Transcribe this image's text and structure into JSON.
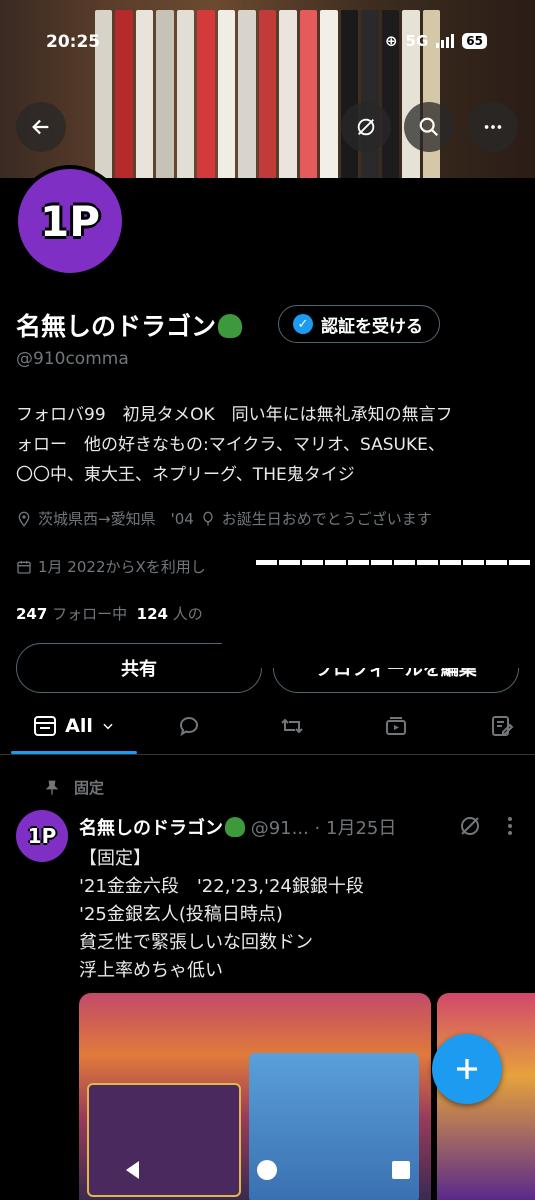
{
  "status_bar": {
    "time": "20:25",
    "network": "5G",
    "battery": "65"
  },
  "profile": {
    "avatar_text": "1P",
    "name": "名無しのドラゴン",
    "verify_button": "認証を受ける",
    "handle": "@910comma",
    "bio_lines": [
      "フォロバ99　初見タメOK　同い年には無礼承知の無言フ",
      "ォロー　他の好きなもの:マイクラ、マリオ、SASUKE、",
      "〇〇中、東大王、ネプリーグ、THE鬼タイジ"
    ],
    "location": "茨城県西→愛知県　'04",
    "birthday": "お誕生日おめでとうございます",
    "joined": "1月 2022からXを利用し",
    "following_count": "247",
    "following_label": "フォロー中",
    "followers_count": "124",
    "followers_label": "人の",
    "share_button": "共有",
    "edit_button": "プロフィールを編集"
  },
  "tabs": {
    "all_label": "All"
  },
  "pinned_post": {
    "pinned_label": "固定",
    "avatar_text": "1P",
    "name": "名無しのドラゴン",
    "handle": "@91...",
    "date": "· 1月25日",
    "text_lines": [
      "【固定】",
      "'21金金六段　'22,'23,'24銀銀十段",
      "'25金銀玄人(投稿日時点)",
      "貧乏性で緊張しいな回数ドン",
      "浮上率めちゃ低い"
    ]
  },
  "colors": {
    "accent": "#1d9bf0",
    "avatar_purple": "#7f2fc4",
    "muted": "#71767b"
  }
}
